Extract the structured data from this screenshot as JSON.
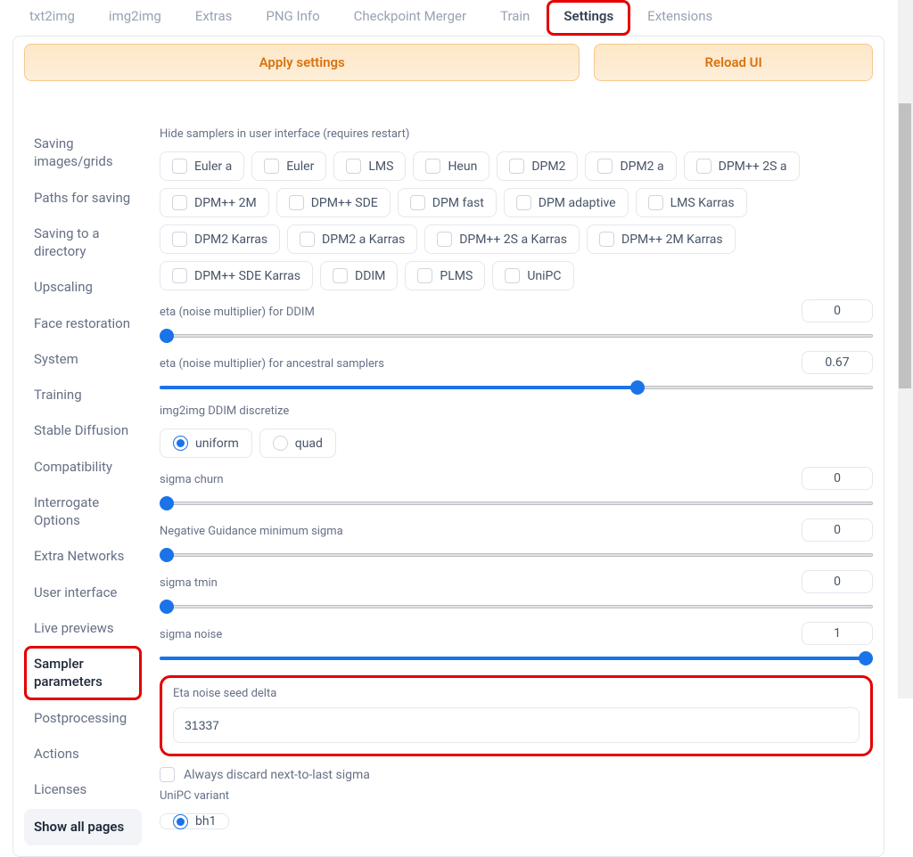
{
  "tabs": [
    "txt2img",
    "img2img",
    "Extras",
    "PNG Info",
    "Checkpoint Merger",
    "Train",
    "Settings",
    "Extensions"
  ],
  "active_tab": 6,
  "buttons": {
    "apply": "Apply settings",
    "reload": "Reload UI"
  },
  "sidebar": {
    "items": [
      "Saving images/grids",
      "Paths for saving",
      "Saving to a directory",
      "Upscaling",
      "Face restoration",
      "System",
      "Training",
      "Stable Diffusion",
      "Compatibility",
      "Interrogate Options",
      "Extra Networks",
      "User interface",
      "Live previews",
      "Sampler parameters",
      "Postprocessing",
      "Actions",
      "Licenses"
    ],
    "active": 13,
    "show_all": "Show all pages"
  },
  "settings": {
    "hide_samplers_label": "Hide samplers in user interface (requires restart)",
    "samplers": [
      "Euler a",
      "Euler",
      "LMS",
      "Heun",
      "DPM2",
      "DPM2 a",
      "DPM++ 2S a",
      "DPM++ 2M",
      "DPM++ SDE",
      "DPM fast",
      "DPM adaptive",
      "LMS Karras",
      "DPM2 Karras",
      "DPM2 a Karras",
      "DPM++ 2S a Karras",
      "DPM++ 2M Karras",
      "DPM++ SDE Karras",
      "DDIM",
      "PLMS",
      "UniPC"
    ],
    "eta_ddim": {
      "label": "eta (noise multiplier) for DDIM",
      "value": "0",
      "pct": 0
    },
    "eta_ancestral": {
      "label": "eta (noise multiplier) for ancestral samplers",
      "value": "0.67",
      "pct": 67
    },
    "ddim_discretize": {
      "label": "img2img DDIM discretize",
      "options": [
        "uniform",
        "quad"
      ],
      "selected": 0
    },
    "sigma_churn": {
      "label": "sigma churn",
      "value": "0",
      "pct": 0
    },
    "neg_guidance": {
      "label": "Negative Guidance minimum sigma",
      "value": "0",
      "pct": 0
    },
    "sigma_tmin": {
      "label": "sigma tmin",
      "value": "0",
      "pct": 0
    },
    "sigma_noise": {
      "label": "sigma noise",
      "value": "1",
      "pct": 100
    },
    "eta_seed_delta": {
      "label": "Eta noise seed delta",
      "value": "31337"
    },
    "discard_sigma": "Always discard next-to-last sigma",
    "unipc_variant": {
      "label": "UniPC variant"
    }
  }
}
